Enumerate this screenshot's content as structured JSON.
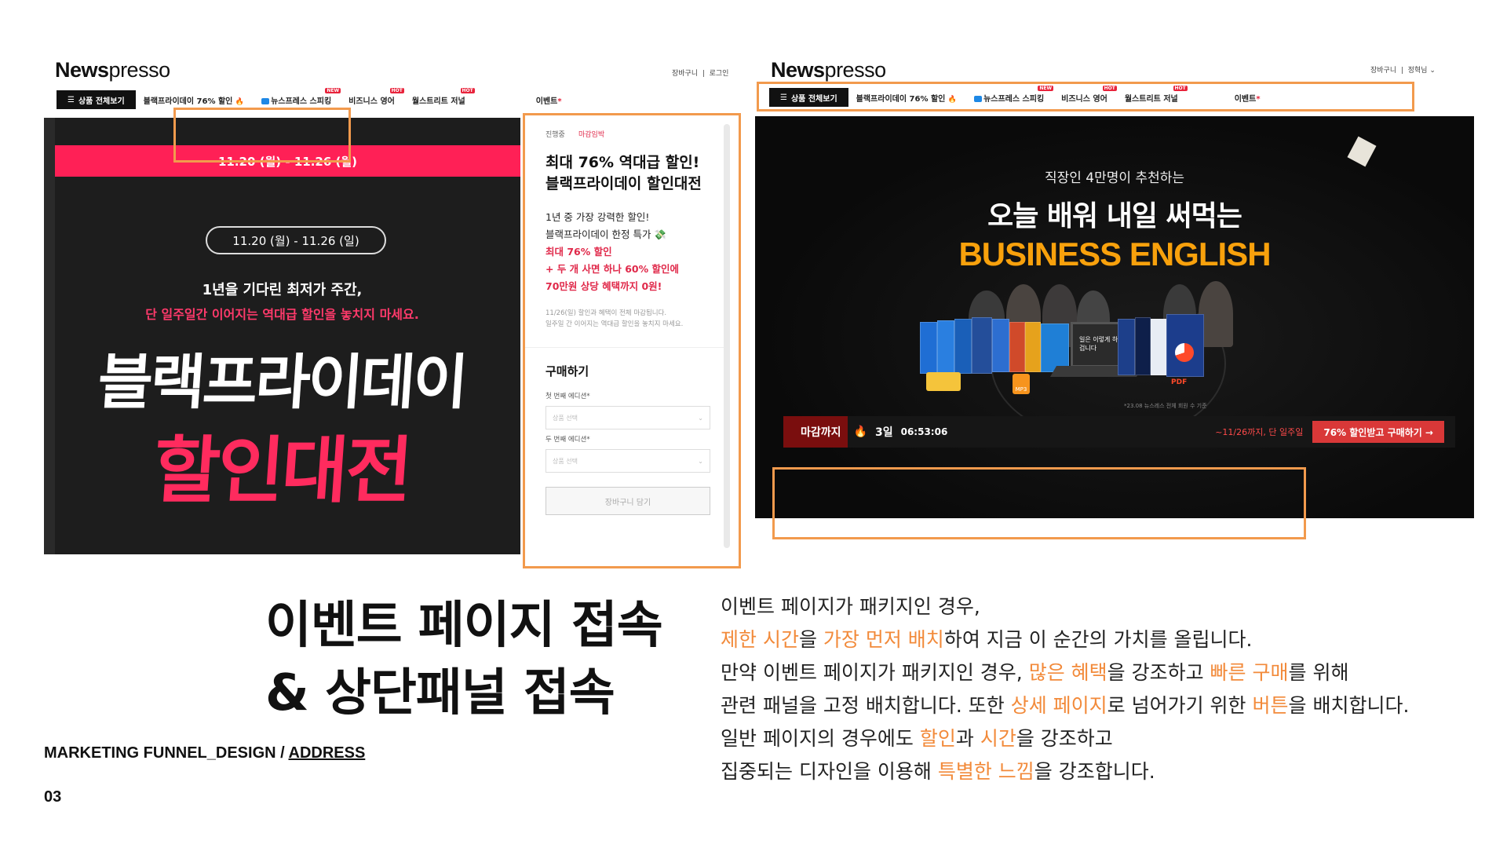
{
  "site": {
    "logo_bold": "News",
    "logo_rest": "presso",
    "util_left": [
      "장바구니",
      "로그인"
    ],
    "util_right": [
      "장바구니",
      "정혁님"
    ],
    "nav_all": "상품 전체보기",
    "nav_items": [
      "블랙프라이데이 76% 할인",
      "뉴스프레스 스피킹",
      "비즈니스 영어",
      "월스트리트 저널",
      "이벤트"
    ],
    "nav_tags": [
      "NEW",
      "HOT",
      "HOT"
    ]
  },
  "left_page": {
    "date_strip": "11.20 (월) - 11.26 (월)",
    "date_pill": "11.20 (월)  -  11.26 (일)",
    "line1": "1년을 기다린 최저가 주간,",
    "line2": "단 일주일간 이어지는 역대급 할인을 놓치지 마세요.",
    "big1": "블랙프라이데이",
    "big2": "할인대전"
  },
  "side_panel": {
    "chip1": "진행중",
    "chip2": "마감임박",
    "title1": "최대 76% 역대급 할인!",
    "title2": "블랙프라이데이 할인대전",
    "p1": "1년 중 가장 강력한 할인!",
    "p2": "블랙프라이데이 한정 특가 💸",
    "p3": "최대 76% 할인",
    "p4": "+ 두 개 사면 하나 60% 할인에",
    "p5": "70만원 상당 혜택까지 0원!",
    "note1": "11/26(일) 할인과 혜택이 전체 마감됩니다.",
    "note2": "일주일 간 이어지는 역대급 할인을 놓치지 마세요.",
    "buy_heading": "구매하기",
    "first_label": "첫 번째 에디션*",
    "second_label": "두 번째 에디션*",
    "select_placeholder": "상품 선택",
    "cart_button": "장바구니 담기"
  },
  "right_page": {
    "sub": "직장인 4만명이 추천하는",
    "title": "오늘 배워 내일 써먹는",
    "english": "BUSINESS ENGLISH",
    "bubble": "일은 이렇게 하는 겁니다",
    "pdf": "PDF",
    "mp3": "MP3",
    "footnote": "*23.08 뉴스레스 전체 회원 수 기준",
    "deadline_label": "마감까지",
    "days": "3일",
    "time": "06:53:06",
    "until": "~11/26까지, 단 일주일",
    "buy_button": "76% 할인받고 구매하기 →"
  },
  "slide": {
    "heading1": "이벤트 페이지 접속",
    "heading2": "& 상단패널 접속",
    "caption_prefix": "MARKETING FUNNEL_DESIGN / ",
    "caption_link": "ADDRESS",
    "page": "03",
    "d1": "이벤트 페이지가 패키지인 경우,",
    "d2_hl1": "제한 시간",
    "d2_a": "을 ",
    "d2_hl2": "가장 먼저 배치",
    "d2_b": "하여 지금 이 순간의 가치를 올립니다.",
    "d3_a": "만약 이벤트 페이지가 패키지인 경우, ",
    "d3_hl1": "많은 혜택",
    "d3_b": "을 강조하고 ",
    "d3_hl2": "빠른 구매",
    "d3_c": "를 위해",
    "d4_a": "관련 패널을 고정 배치합니다. 또한 ",
    "d4_hl1": "상세 페이지",
    "d4_b": "로 넘어가기 위한 ",
    "d4_hl2": "버튼",
    "d4_c": "을 배치합니다.",
    "d5_a": "일반 페이지의 경우에도 ",
    "d5_hl1": "할인",
    "d5_b": "과 ",
    "d5_hl2": "시간",
    "d5_c": "을 강조하고",
    "d6_a": "집중되는 디자인을 이용해 ",
    "d6_hl1": "특별한 느낌",
    "d6_b": "을 강조합니다."
  },
  "colors": {
    "accent_orange": "#f29a4d",
    "pink": "#ff2056",
    "gold": "#f8a10c",
    "highlight": "#f28a3a"
  }
}
